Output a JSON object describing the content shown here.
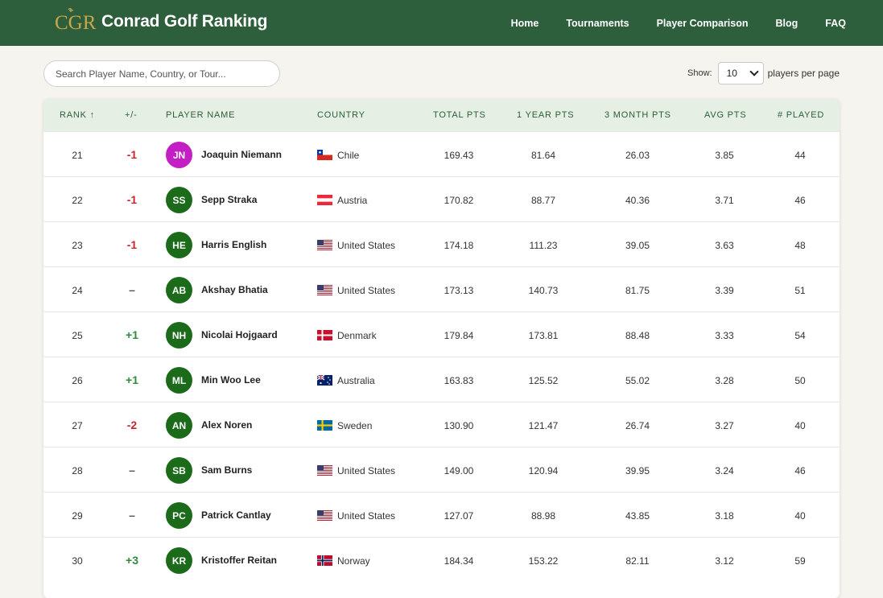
{
  "header": {
    "logo_text": "CGR",
    "brand": "Conrad Golf Ranking",
    "nav": [
      "Home",
      "Tournaments",
      "Player Comparison",
      "Blog",
      "FAQ"
    ]
  },
  "search": {
    "placeholder": "Search Player Name, Country, or Tour..."
  },
  "show": {
    "label": "Show:",
    "value": "10",
    "suffix": "players per page"
  },
  "table": {
    "columns": [
      "RANK ↑",
      "+/-",
      "PLAYER NAME",
      "COUNTRY",
      "TOTAL PTS",
      "1 YEAR PTS",
      "3 MONTH PTS",
      "AVG PTS",
      "# PLAYED"
    ],
    "rows": [
      {
        "rank": "21",
        "change": "-1",
        "dir": "down",
        "initials": "JN",
        "avatar_color": "#c41fc4",
        "name": "Joaquin Niemann",
        "country": "Chile",
        "flag": "cl",
        "total": "169.43",
        "year": "81.64",
        "three_month": "26.03",
        "avg": "3.85",
        "played": "44"
      },
      {
        "rank": "22",
        "change": "-1",
        "dir": "down",
        "initials": "SS",
        "avatar_color": "#1b6b1b",
        "name": "Sepp Straka",
        "country": "Austria",
        "flag": "at",
        "total": "170.82",
        "year": "88.77",
        "three_month": "40.36",
        "avg": "3.71",
        "played": "46"
      },
      {
        "rank": "23",
        "change": "-1",
        "dir": "down",
        "initials": "HE",
        "avatar_color": "#1b6b1b",
        "name": "Harris English",
        "country": "United States",
        "flag": "us",
        "total": "174.18",
        "year": "111.23",
        "three_month": "39.05",
        "avg": "3.63",
        "played": "48"
      },
      {
        "rank": "24",
        "change": "–",
        "dir": "none",
        "initials": "AB",
        "avatar_color": "#1b6b1b",
        "name": "Akshay Bhatia",
        "country": "United States",
        "flag": "us",
        "total": "173.13",
        "year": "140.73",
        "three_month": "81.75",
        "avg": "3.39",
        "played": "51"
      },
      {
        "rank": "25",
        "change": "+1",
        "dir": "up",
        "initials": "NH",
        "avatar_color": "#1b6b1b",
        "name": "Nicolai Hojgaard",
        "country": "Denmark",
        "flag": "dk",
        "total": "179.84",
        "year": "173.81",
        "three_month": "88.48",
        "avg": "3.33",
        "played": "54"
      },
      {
        "rank": "26",
        "change": "+1",
        "dir": "up",
        "initials": "ML",
        "avatar_color": "#1b6b1b",
        "name": "Min Woo Lee",
        "country": "Australia",
        "flag": "au",
        "total": "163.83",
        "year": "125.52",
        "three_month": "55.02",
        "avg": "3.28",
        "played": "50"
      },
      {
        "rank": "27",
        "change": "-2",
        "dir": "down",
        "initials": "AN",
        "avatar_color": "#1b6b1b",
        "name": "Alex Noren",
        "country": "Sweden",
        "flag": "se",
        "total": "130.90",
        "year": "121.47",
        "three_month": "26.74",
        "avg": "3.27",
        "played": "40"
      },
      {
        "rank": "28",
        "change": "–",
        "dir": "none",
        "initials": "SB",
        "avatar_color": "#1b6b1b",
        "name": "Sam Burns",
        "country": "United States",
        "flag": "us",
        "total": "149.00",
        "year": "120.94",
        "three_month": "39.95",
        "avg": "3.24",
        "played": "46"
      },
      {
        "rank": "29",
        "change": "–",
        "dir": "none",
        "initials": "PC",
        "avatar_color": "#1b6b1b",
        "name": "Patrick Cantlay",
        "country": "United States",
        "flag": "us",
        "total": "127.07",
        "year": "88.98",
        "three_month": "43.85",
        "avg": "3.18",
        "played": "40"
      },
      {
        "rank": "30",
        "change": "+3",
        "dir": "up",
        "initials": "KR",
        "avatar_color": "#1b6b1b",
        "name": "Kristoffer Reitan",
        "country": "Norway",
        "flag": "no",
        "total": "184.34",
        "year": "153.22",
        "three_month": "82.11",
        "avg": "3.12",
        "played": "59"
      }
    ]
  }
}
